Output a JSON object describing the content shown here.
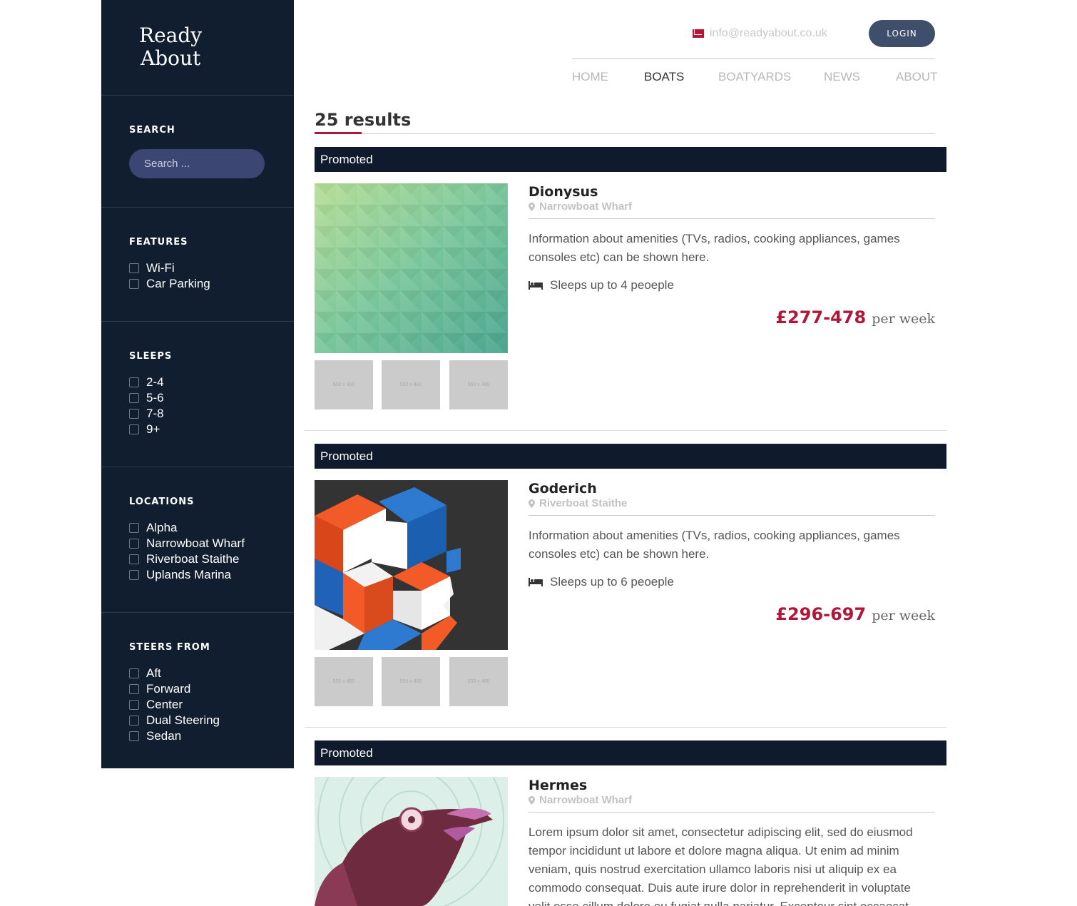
{
  "brand": {
    "line1": "Ready",
    "line2": "About"
  },
  "sidebar": {
    "search": {
      "title": "SEARCH",
      "placeholder": "Search ..."
    },
    "features": {
      "title": "FEATURES",
      "options": [
        "Wi-Fi",
        "Car Parking"
      ]
    },
    "sleeps": {
      "title": "SLEEPS",
      "options": [
        "2-4",
        "5-6",
        "7-8",
        "9+"
      ]
    },
    "locations": {
      "title": "LOCATIONS",
      "options": [
        "Alpha",
        "Narrowboat Wharf",
        "Riverboat Staithe",
        "Uplands Marina"
      ]
    },
    "steers": {
      "title": "STEERS FROM",
      "options": [
        "Aft",
        "Forward",
        "Center",
        "Dual Steering",
        "Sedan"
      ]
    }
  },
  "header": {
    "email": "info@readyabout.co.uk",
    "login": "LOGIN",
    "nav": [
      "HOME",
      "BOATS",
      "BOATYARDS",
      "NEWS",
      "ABOUT"
    ],
    "active_nav": "BOATS"
  },
  "results": {
    "count_label": "25 results",
    "placeholder_label": "550 x 460",
    "listings": [
      {
        "badge": "Promoted",
        "name": "Dionysus",
        "location": "Narrowboat Wharf",
        "description": "Information about amenities (TVs, radios, cooking appliances, games consoles etc) can be shown here.",
        "sleeps": "Sleeps up to 4 peoeple",
        "price": "£277-478",
        "price_unit": "per week"
      },
      {
        "badge": "Promoted",
        "name": "Goderich",
        "location": "Riverboat Staithe",
        "description": "Information about amenities (TVs, radios, cooking appliances, games consoles etc) can be shown here.",
        "sleeps": "Sleeps up to 6 peoeple",
        "price": "£296-697",
        "price_unit": "per week"
      },
      {
        "badge": "Promoted",
        "name": "Hermes",
        "location": "Narrowboat Wharf",
        "description": "Lorem ipsum dolor sit amet, consectetur adipiscing elit, sed do eiusmod tempor incididunt ut labore et dolore magna aliqua. Ut enim ad minim veniam, quis nostrud exercitation ullamco laboris nisi ut aliquip ex ea commodo consequat. Duis aute irure dolor in reprehenderit in voluptate velit esse cillum dolore eu fugiat nulla pariatur. Excepteur sint occaecat"
      }
    ]
  },
  "colors": {
    "sidebar": "#111e30",
    "accent": "#b0173a",
    "promo": "#0f1b2c",
    "login": "#3f4e6a",
    "search": "#3b4673"
  }
}
